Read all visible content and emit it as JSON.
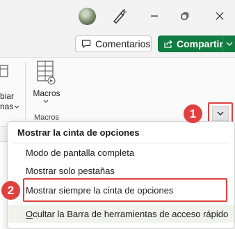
{
  "titlebar": {
    "avatar_icon": "user-avatar",
    "pen_icon": "pen-brush-icon",
    "window_controls": [
      "minimize-icon",
      "restore-icon",
      "close-icon"
    ]
  },
  "toolbar": {
    "comments_label": "Comentarios",
    "share_label": "Compartir",
    "accent": "#107c41"
  },
  "ribbon": {
    "cut_text_line1": "biar",
    "cut_text_line2": "nas",
    "macros_label": "Macros",
    "macros_group_label": "Macros"
  },
  "menu": {
    "header": "Mostrar la cinta de opciones",
    "items": [
      {
        "label": "Modo de pantalla completa"
      },
      {
        "label": "Mostrar solo pestañas"
      },
      {
        "label": "Mostrar siempre la cinta de opciones"
      },
      {
        "label": "Ocultar la Barra de herramientas de acceso rápido",
        "hotkey": "O"
      }
    ]
  },
  "annotations": {
    "step1": "1",
    "step2": "2",
    "highlight_color": "#e0413f"
  }
}
